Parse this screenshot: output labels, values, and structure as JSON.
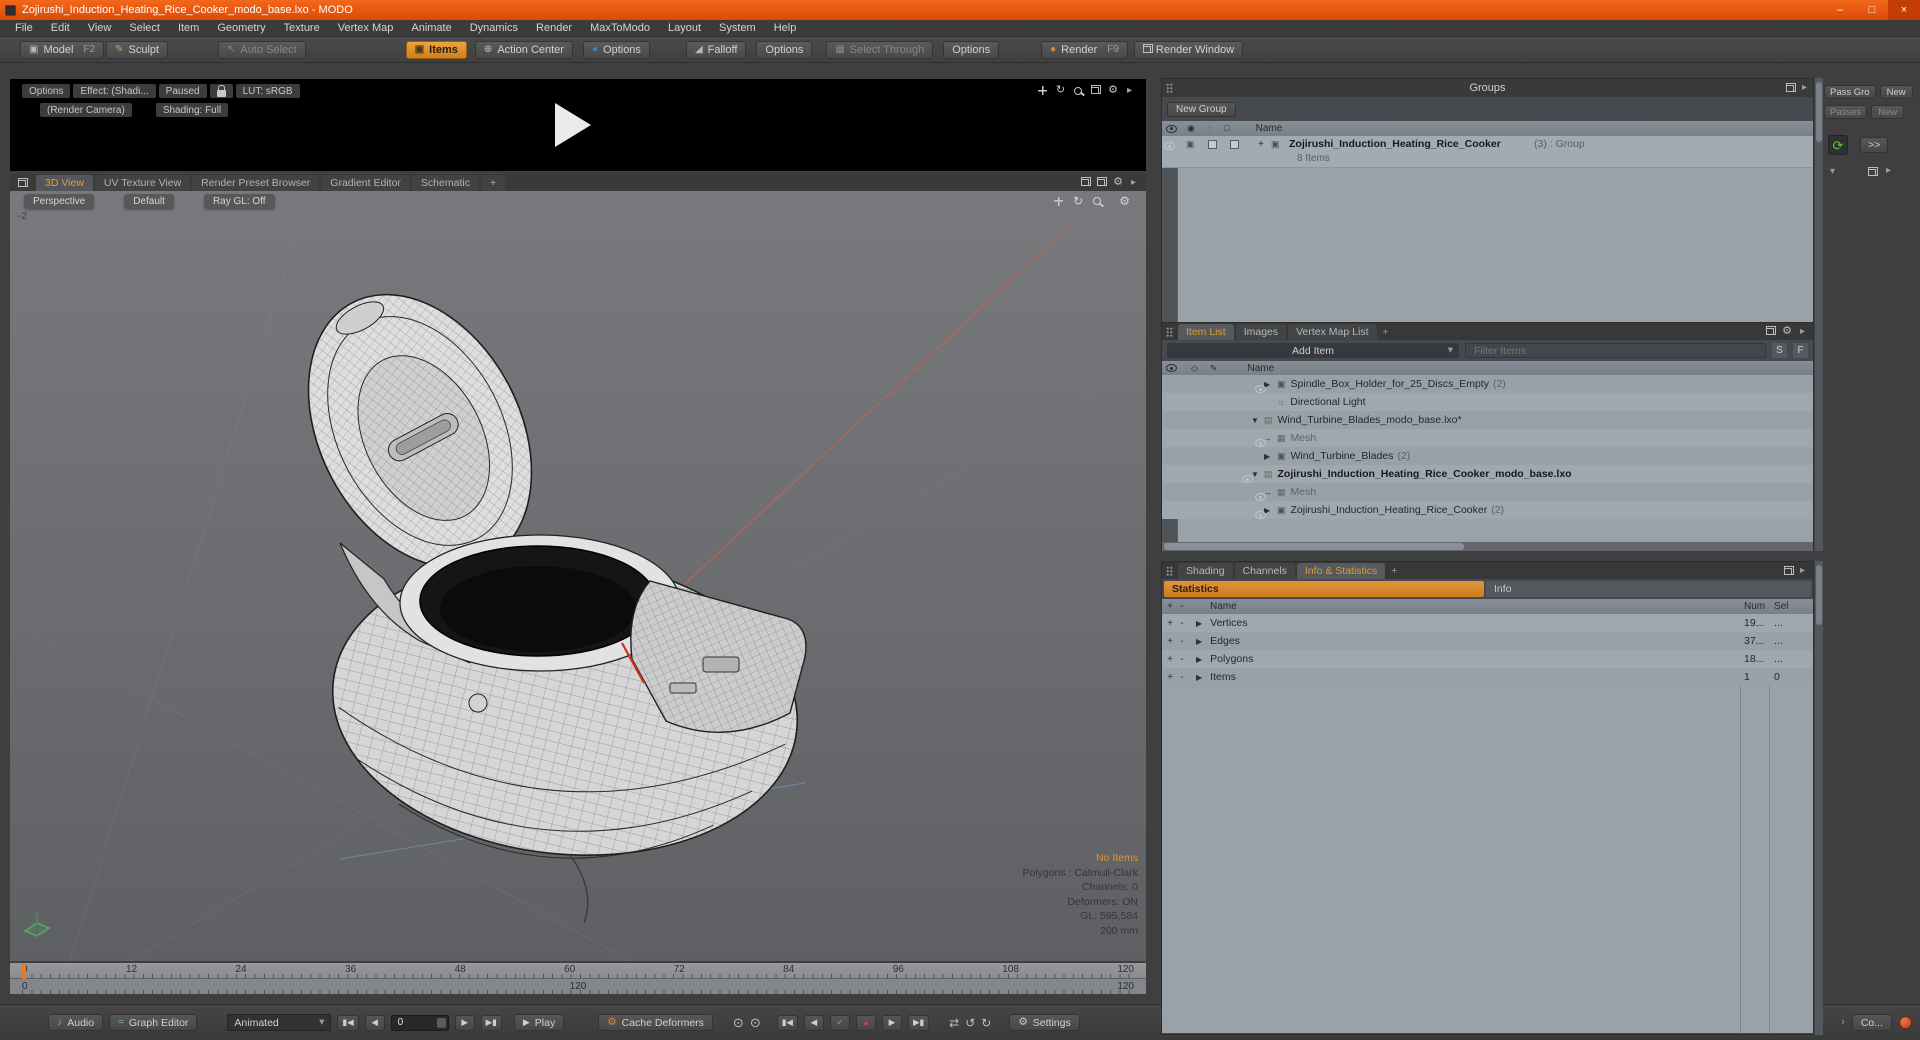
{
  "colors": {
    "accent_orange": "#e08b2d",
    "titlebar_orange": "#e65510",
    "record_red": "#d9512c"
  },
  "window": {
    "title": "Zojirushi_Induction_Heating_Rice_Cooker_modo_base.lxo - MODO",
    "minimize": "–",
    "maximize": "□",
    "close": "×"
  },
  "menubar": {
    "items": [
      "File",
      "Edit",
      "View",
      "Select",
      "Item",
      "Geometry",
      "Texture",
      "Vertex Map",
      "Animate",
      "Dynamics",
      "Render",
      "MaxToModo",
      "Layout",
      "System",
      "Help"
    ]
  },
  "toolbar": {
    "model": "Model",
    "model_hint": "F2",
    "sculpt": "Sculpt",
    "auto_select": "Auto Select",
    "items_mode": "Items",
    "action_center": "Action Center",
    "options_a": "Options",
    "falloff": "Falloff",
    "options_b": "Options",
    "select_through": "Select Through",
    "options_c": "Options",
    "render": "Render",
    "render_hint": "F9",
    "render_window": "Render Window"
  },
  "preview": {
    "options": "Options",
    "effect": "Effect: (Shadi...",
    "paused": "Paused",
    "lut": "LUT: sRGB",
    "render_camera": "(Render Camera)",
    "shading": "Shading: Full"
  },
  "viewport": {
    "tabs": [
      {
        "label": "3D View",
        "active": true
      },
      {
        "label": "UV Texture View"
      },
      {
        "label": "Render Preset Browser"
      },
      {
        "label": "Gradient Editor"
      },
      {
        "label": "Schematic"
      },
      {
        "label": "+",
        "plus": true
      }
    ],
    "perspective": "Perspective",
    "camera_default": "Default",
    "raygl": "Ray GL: Off",
    "corner_label": "-2",
    "status_highlight": "No Items",
    "status_lines": [
      "Polygons : Catmull-Clark",
      "Channels: 0",
      "Deformers: ON",
      "GL: 595,584",
      "200 mm"
    ]
  },
  "timeline": {
    "ticks": [
      "0",
      "12",
      "24",
      "36",
      "48",
      "60",
      "72",
      "84",
      "96",
      "108",
      "120"
    ],
    "range_start": "0",
    "range_mid": "120",
    "range_end": "120"
  },
  "transport": {
    "audio": "Audio",
    "graph_editor": "Graph Editor",
    "anim_mode": "Animated",
    "frame": "0",
    "play": "Play",
    "cache_deformers": "Cache Deformers",
    "settings": "Settings",
    "command_btn": "Co...",
    "icons": {
      "start": "▮◀",
      "prev": "◀",
      "next": "▶",
      "end": "▶▮",
      "tri": "▶",
      "check": "✓",
      "record": "●",
      "swap": "⇄",
      "undo": "↺",
      "redo": "↻",
      "circle": "⊙",
      "note": "♪",
      "curve": "≈",
      "gear": "⚙",
      "chev": "▾",
      "more": "›"
    }
  },
  "groups_panel": {
    "title": "Groups",
    "new_group": "New Group",
    "name_col": "Name",
    "col_icons": {
      "render": "◉",
      "ghost": "◌",
      "lock": "□"
    },
    "row": {
      "expander": "+",
      "glyph": "▣",
      "label": "Zojirushi_Induction_Heating_Rice_Cooker",
      "suffix": " (3) : Group",
      "sub": "8 Items"
    }
  },
  "passes_strip": {
    "pass_group": "Pass Gro",
    "new1": "New",
    "passes": "Passes",
    "new2": "New",
    "forward": ">>",
    "recycle": "⟳",
    "chev": "▾"
  },
  "item_list": {
    "tabs": [
      {
        "label": "Item List",
        "active": true
      },
      {
        "label": "Images"
      },
      {
        "label": "Vertex Map List"
      },
      {
        "label": "+",
        "plus": true
      }
    ],
    "add_item": "Add Item",
    "filter_placeholder": "Filter Items",
    "s_btn": "S",
    "f_btn": "F",
    "name_col": "Name",
    "col_icons": {
      "locator": "◇",
      "edit": "✎"
    },
    "rows": [
      {
        "marker": "▶",
        "glyph": "▣",
        "cls": "ic-group",
        "icon": "item-group-icon",
        "label": "Spindle_Box_Holder_for_25_Discs_Empty",
        "suffix": "(2)",
        "eye": true,
        "ind1": true
      },
      {
        "marker": "",
        "glyph": "☼",
        "cls": "ic-light",
        "icon": "light-icon",
        "label": "Directional Light",
        "ind1": true
      },
      {
        "marker": "▼",
        "glyph": "▤",
        "cls": "ic-scene",
        "icon": "scene-icon",
        "label": "Wind_Turbine_Blades_modo_base.lxo*"
      },
      {
        "marker": "→",
        "glyph": "▦",
        "cls": "ic-mesh",
        "icon": "mesh-icon",
        "label": "Mesh",
        "dim": true,
        "eye": true,
        "ind1": true
      },
      {
        "marker": "▶",
        "glyph": "▣",
        "cls": "ic-group",
        "icon": "item-group-icon",
        "label": "Wind_Turbine_Blades",
        "suffix": "(2)",
        "ind1": true
      },
      {
        "marker": "▼",
        "glyph": "▤",
        "cls": "ic-scene",
        "icon": "scene-icon",
        "label": "Zojirushi_Induction_Heating_Rice_Cooker_modo_base.lxo",
        "bold": true,
        "eye": true
      },
      {
        "marker": "→",
        "glyph": "▦",
        "cls": "ic-mesh",
        "icon": "mesh-icon",
        "label": "Mesh",
        "dim": true,
        "eye": true,
        "ind1": true
      },
      {
        "marker": "▶",
        "glyph": "▣",
        "cls": "ic-group",
        "icon": "item-group-icon",
        "label": "Zojirushi_Induction_Heating_Rice_Cooker",
        "suffix": "(2)",
        "eye": true,
        "ind1": true
      }
    ]
  },
  "stats_panel": {
    "tabs": [
      {
        "label": "Shading"
      },
      {
        "label": "Channels"
      },
      {
        "label": "Info & Statistics",
        "active": true
      },
      {
        "label": "+",
        "plus": true
      }
    ],
    "subtab_statistics": "Statistics",
    "subtab_info": "Info",
    "cols": {
      "name": "Name",
      "num": "Num",
      "sel": "Sel"
    },
    "rows": [
      {
        "name": "Vertices",
        "num": "19...",
        "sel": "..."
      },
      {
        "name": "Edges",
        "num": "37...",
        "sel": "..."
      },
      {
        "name": "Polygons",
        "num": "18...",
        "sel": "..."
      },
      {
        "name": "Items",
        "num": "1",
        "sel": "0"
      }
    ]
  },
  "icons": {
    "gear": "⚙",
    "arrow": "▸",
    "tri_down": "▼",
    "tri_right": "▶",
    "rotate": "↻",
    "chev_down": "▾",
    "plus": "+",
    "minus": "-"
  }
}
